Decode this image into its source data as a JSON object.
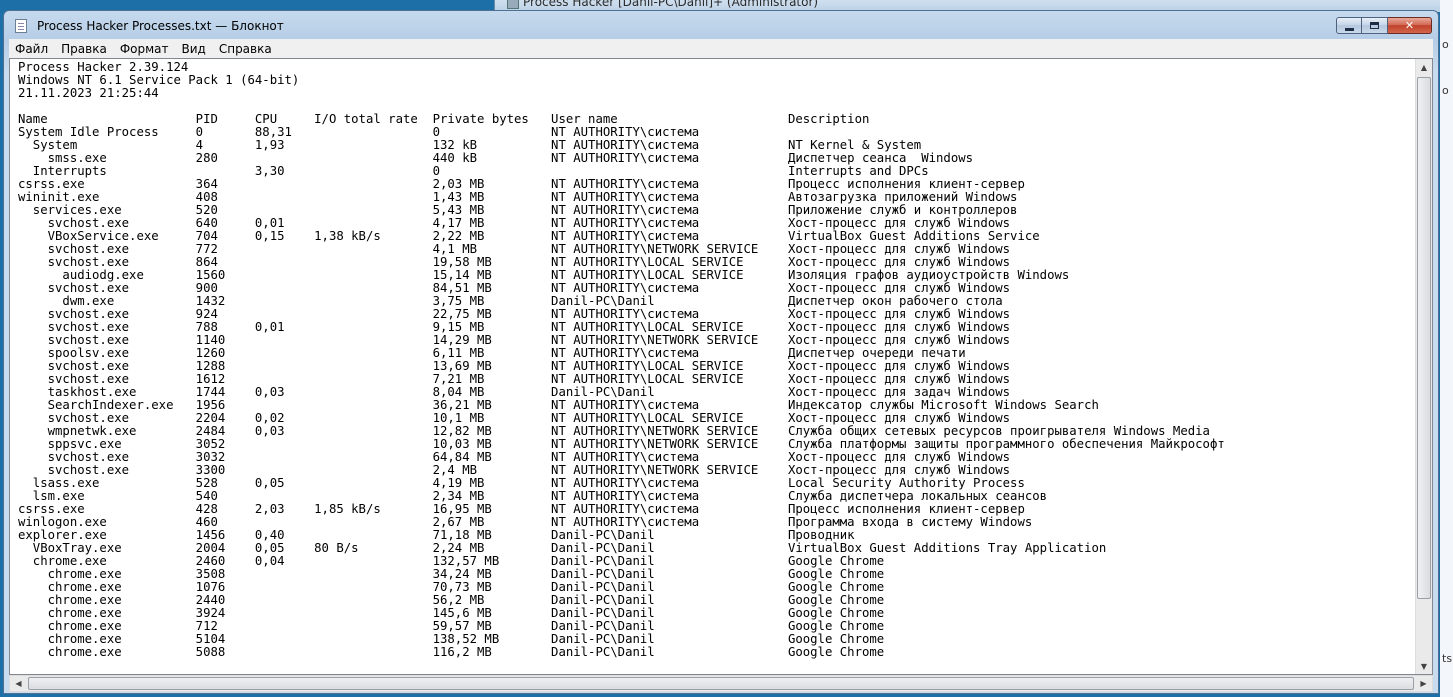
{
  "background_window": {
    "title": "Process Hacker [Danil-PC\\Danil]+ (Administrator)"
  },
  "right_edge_glyphs": [
    "о",
    "о",
    "ts"
  ],
  "window": {
    "title": "Process Hacker Processes.txt — Блокнот",
    "icon": "notepad-icon"
  },
  "menu": {
    "items": [
      "Файл",
      "Правка",
      "Формат",
      "Вид",
      "Справка"
    ]
  },
  "document": {
    "lines": [
      "Process Hacker 2.39.124",
      "Windows NT 6.1 Service Pack 1 (64-bit)",
      "21.11.2023 21:25:44",
      "",
      "Name                    PID     CPU     I/O total rate  Private bytes   User name                       Description",
      "System Idle Process     0       88,31                   0               NT AUTHORITY\\система",
      "  System                4       1,93                    132 kB          NT AUTHORITY\\система            NT Kernel & System",
      "    smss.exe            280                             440 kB          NT AUTHORITY\\система            Диспетчер сеанса  Windows",
      "  Interrupts                    3,30                    0                                               Interrupts and DPCs",
      "csrss.exe               364                             2,03 MB         NT AUTHORITY\\система            Процесс исполнения клиент-сервер",
      "wininit.exe             408                             1,43 MB         NT AUTHORITY\\система            Автозагрузка приложений Windows",
      "  services.exe          520                             5,43 MB         NT AUTHORITY\\система            Приложение служб и контроллеров",
      "    svchost.exe         640     0,01                    4,17 MB         NT AUTHORITY\\система            Хост-процесс для служб Windows",
      "    VBoxService.exe     704     0,15    1,38 kB/s       2,22 MB         NT AUTHORITY\\система            VirtualBox Guest Additions Service",
      "    svchost.exe         772                             4,1 MB          NT AUTHORITY\\NETWORK SERVICE    Хост-процесс для служб Windows",
      "    svchost.exe         864                             19,58 MB        NT AUTHORITY\\LOCAL SERVICE      Хост-процесс для служб Windows",
      "      audiodg.exe       1560                            15,14 MB        NT AUTHORITY\\LOCAL SERVICE      Изоляция графов аудиоустройств Windows",
      "    svchost.exe         900                             84,51 MB        NT AUTHORITY\\система            Хост-процесс для служб Windows",
      "      dwm.exe           1432                            3,75 MB         Danil-PC\\Danil                  Диспетчер окон рабочего стола",
      "    svchost.exe         924                             22,75 MB        NT AUTHORITY\\система            Хост-процесс для служб Windows",
      "    svchost.exe         788     0,01                    9,15 MB         NT AUTHORITY\\LOCAL SERVICE      Хост-процесс для служб Windows",
      "    svchost.exe         1140                            14,29 MB        NT AUTHORITY\\NETWORK SERVICE    Хост-процесс для служб Windows",
      "    spoolsv.exe         1260                            6,11 MB         NT AUTHORITY\\система            Диспетчер очереди печати",
      "    svchost.exe         1288                            13,69 MB        NT AUTHORITY\\LOCAL SERVICE      Хост-процесс для служб Windows",
      "    svchost.exe         1612                            7,21 MB         NT AUTHORITY\\LOCAL SERVICE      Хост-процесс для служб Windows",
      "    taskhost.exe        1744    0,03                    8,04 MB         Danil-PC\\Danil                  Хост-процесс для задач Windows",
      "    SearchIndexer.exe   1956                            36,21 MB        NT AUTHORITY\\система            Индексатор службы Microsoft Windows Search",
      "    svchost.exe         2204    0,02                    10,1 MB         NT AUTHORITY\\LOCAL SERVICE      Хост-процесс для служб Windows",
      "    wmpnetwk.exe        2484    0,03                    12,82 MB        NT AUTHORITY\\NETWORK SERVICE    Служба общих сетевых ресурсов проигрывателя Windows Media",
      "    sppsvc.exe          3052                            10,03 MB        NT AUTHORITY\\NETWORK SERVICE    Служба платформы защиты программного обеспечения Майкрософт",
      "    svchost.exe         3032                            64,84 MB        NT AUTHORITY\\система            Хост-процесс для служб Windows",
      "    svchost.exe         3300                            2,4 MB          NT AUTHORITY\\NETWORK SERVICE    Хост-процесс для служб Windows",
      "  lsass.exe             528     0,05                    4,19 MB         NT AUTHORITY\\система            Local Security Authority Process",
      "  lsm.exe               540                             2,34 MB         NT AUTHORITY\\система            Служба диспетчера локальных сеансов",
      "csrss.exe               428     2,03    1,85 kB/s       16,95 MB        NT AUTHORITY\\система            Процесс исполнения клиент-сервер",
      "winlogon.exe            460                             2,67 MB         NT AUTHORITY\\система            Программа входа в систему Windows",
      "explorer.exe            1456    0,40                    71,18 MB        Danil-PC\\Danil                  Проводник",
      "  VBoxTray.exe          2004    0,05    80 B/s          2,24 MB         Danil-PC\\Danil                  VirtualBox Guest Additions Tray Application",
      "  chrome.exe            2460    0,04                    132,57 MB       Danil-PC\\Danil                  Google Chrome",
      "    chrome.exe          3508                            34,24 MB        Danil-PC\\Danil                  Google Chrome",
      "    chrome.exe          1076                            70,73 MB        Danil-PC\\Danil                  Google Chrome",
      "    chrome.exe          2440                            56,2 MB         Danil-PC\\Danil                  Google Chrome",
      "    chrome.exe          3924                            145,6 MB        Danil-PC\\Danil                  Google Chrome",
      "    chrome.exe          712                             59,57 MB        Danil-PC\\Danil                  Google Chrome",
      "    chrome.exe          5104                            138,52 MB       Danil-PC\\Danil                  Google Chrome",
      "    chrome.exe          5088                            116,2 MB        Danil-PC\\Danil                  Google Chrome"
    ]
  },
  "scrollbars": {
    "vertical_up_icon": "arrow-up-icon",
    "vertical_down_icon": "arrow-down-icon",
    "horizontal_left_icon": "arrow-left-icon",
    "horizontal_right_icon": "arrow-right-icon"
  },
  "colors": {
    "desktop": "#1d6fa8",
    "titlebar": "#b5cde6",
    "close_button": "#c2412a"
  }
}
